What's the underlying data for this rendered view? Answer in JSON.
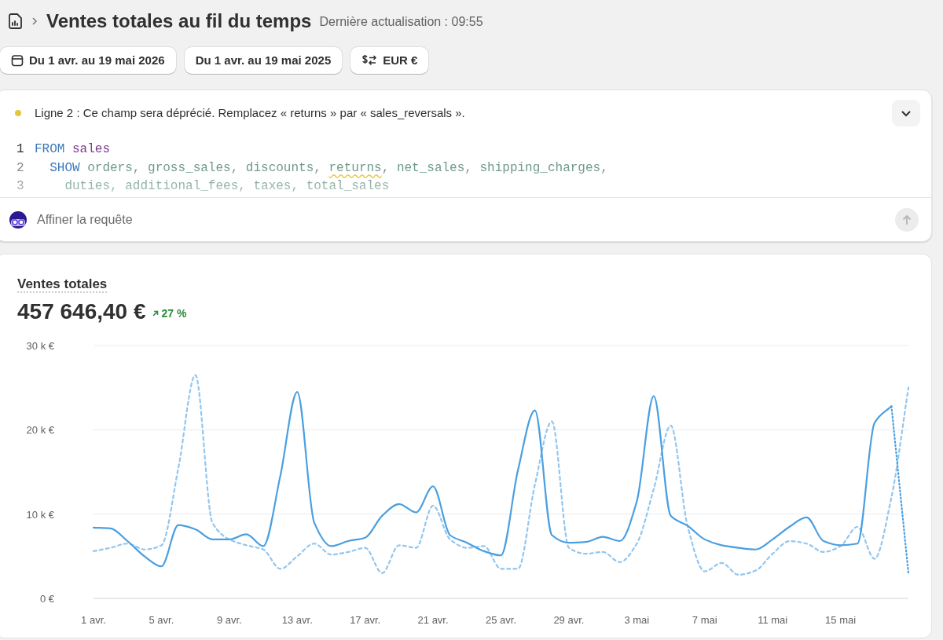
{
  "header": {
    "title": "Ventes totales au fil du temps",
    "updated": "Dernière actualisation : 09:55"
  },
  "filters": [
    {
      "kind": "date",
      "label": "Du 1 avr. au 19 mai 2026"
    },
    {
      "kind": "compare",
      "label": "Du 1 avr. au 19 mai 2025"
    },
    {
      "kind": "currency",
      "label": "EUR €"
    }
  ],
  "editor": {
    "warning": {
      "color": "#e2c73a",
      "message": "Ligne 2 : Ce champ sera déprécié. Remplacez « returns » par « sales_reversals »."
    },
    "lines": [
      {
        "number": "1",
        "tokens": [
          {
            "text": "FROM",
            "kind": "keyword"
          },
          {
            "text": " sales",
            "kind": "table"
          }
        ]
      },
      {
        "number": "2",
        "tokens": [
          {
            "text": "  SHOW",
            "kind": "keyword"
          },
          {
            "text": " orders, gross_sales, discounts, ",
            "kind": "field"
          },
          {
            "text": "returns",
            "kind": "warning"
          },
          {
            "text": ", net_sales, shipping_charges,",
            "kind": "field"
          }
        ]
      },
      {
        "number": "3",
        "tokens": [
          {
            "text": "    duties, additional_fees, taxes, total_sales",
            "kind": "field"
          }
        ]
      }
    ],
    "prompt": {
      "placeholder": "Affiner la requête"
    }
  },
  "metric": {
    "label": "Ventes totales",
    "value": "457 646,40 €",
    "change": "27 %"
  },
  "chart_data": {
    "type": "line",
    "categories": [
      "1 avr.",
      null,
      null,
      null,
      "5 avr.",
      null,
      null,
      null,
      "9 avr.",
      null,
      null,
      null,
      "13 avr.",
      null,
      null,
      null,
      "17 avr.",
      null,
      null,
      null,
      "21 avr.",
      null,
      null,
      null,
      "25 avr.",
      null,
      null,
      null,
      "29 avr.",
      null,
      null,
      null,
      "3 mai",
      null,
      null,
      null,
      "7 mai",
      null,
      null,
      null,
      "11 mai",
      null,
      null,
      null,
      "15 mai",
      null,
      null,
      null,
      null
    ],
    "series": [
      {
        "color": "#4a9fe0",
        "line_style": "solid",
        "values": [
          8400,
          8300,
          6800,
          5000,
          3800,
          8700,
          8200,
          7000,
          7000,
          7600,
          6200,
          14500,
          24500,
          9000,
          6200,
          6800,
          7200,
          9800,
          11200,
          10200,
          13300,
          7500,
          6600,
          5600,
          5100,
          15200,
          22300,
          7500,
          6600,
          6700,
          7300,
          6800,
          11500,
          24000,
          9800,
          8600,
          7000,
          6300,
          6000,
          5800,
          7000,
          8500,
          9600,
          6800,
          6300,
          6500,
          20800,
          22800,
          null
        ]
      },
      {
        "color": "#4a9fe0",
        "line_style": "dotted",
        "values": [
          null,
          null,
          null,
          null,
          null,
          null,
          null,
          null,
          null,
          null,
          null,
          null,
          null,
          null,
          null,
          null,
          null,
          null,
          null,
          null,
          null,
          null,
          null,
          null,
          null,
          null,
          null,
          null,
          null,
          null,
          null,
          null,
          null,
          null,
          null,
          null,
          null,
          null,
          null,
          null,
          null,
          null,
          null,
          null,
          null,
          null,
          null,
          22800,
          3000
        ]
      },
      {
        "color": "#93c6ee",
        "line_style": "dashed",
        "values": [
          5600,
          6000,
          6500,
          5800,
          6300,
          15500,
          26500,
          9000,
          7000,
          6300,
          5800,
          3500,
          5000,
          6500,
          5200,
          5500,
          6000,
          3000,
          6300,
          6000,
          11000,
          7000,
          6000,
          6200,
          3500,
          3500,
          13500,
          21000,
          6000,
          5300,
          5500,
          4300,
          6500,
          13000,
          20500,
          8500,
          3200,
          4200,
          2800,
          3300,
          5300,
          6800,
          6500,
          5500,
          6200,
          8500,
          4700,
          12000,
          25000
        ]
      }
    ],
    "ylim": [
      0,
      30000
    ],
    "yticks": [
      {
        "value": 0,
        "label": "0 €"
      },
      {
        "value": 10000,
        "label": "10 k €"
      },
      {
        "value": 20000,
        "label": "20 k €"
      },
      {
        "value": 30000,
        "label": "30 k €"
      }
    ]
  }
}
